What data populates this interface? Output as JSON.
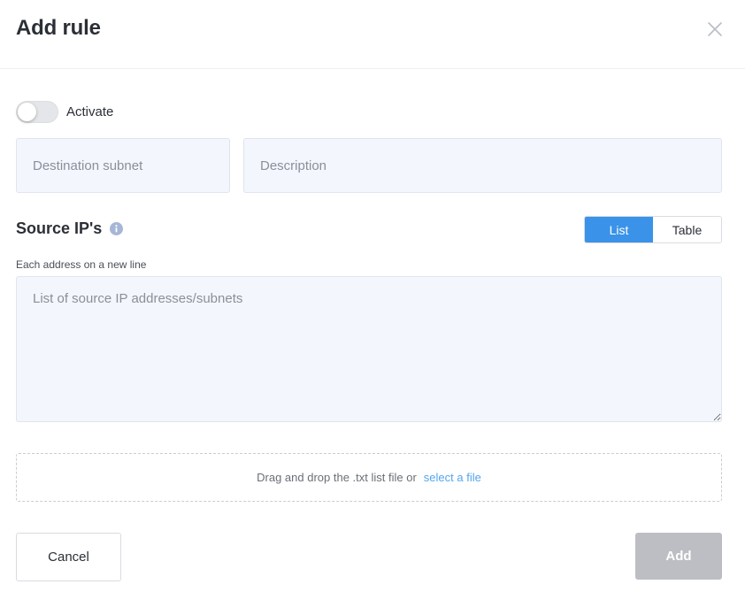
{
  "dialog": {
    "title": "Add rule"
  },
  "activate": {
    "label": "Activate",
    "enabled": false
  },
  "fields": {
    "destination_subnet": {
      "placeholder": "Destination subnet",
      "value": ""
    },
    "description": {
      "placeholder": "Description",
      "value": ""
    }
  },
  "source_ips": {
    "title": "Source IP's",
    "view_options": [
      "List",
      "Table"
    ],
    "selected_view": "List",
    "hint": "Each address on a new line",
    "textarea_placeholder": "List of source IP addresses/subnets",
    "dropzone_text": "Drag and drop the .txt list file or",
    "dropzone_link": "select a file"
  },
  "footer": {
    "cancel_label": "Cancel",
    "add_label": "Add",
    "add_enabled": false
  },
  "colors": {
    "accent": "#3a93e8",
    "link": "#55a6ec",
    "disabled_button": "#bcbec3",
    "field_background": "#f3f6fd"
  },
  "icons": {
    "close": "close-icon",
    "info": "info-icon"
  }
}
